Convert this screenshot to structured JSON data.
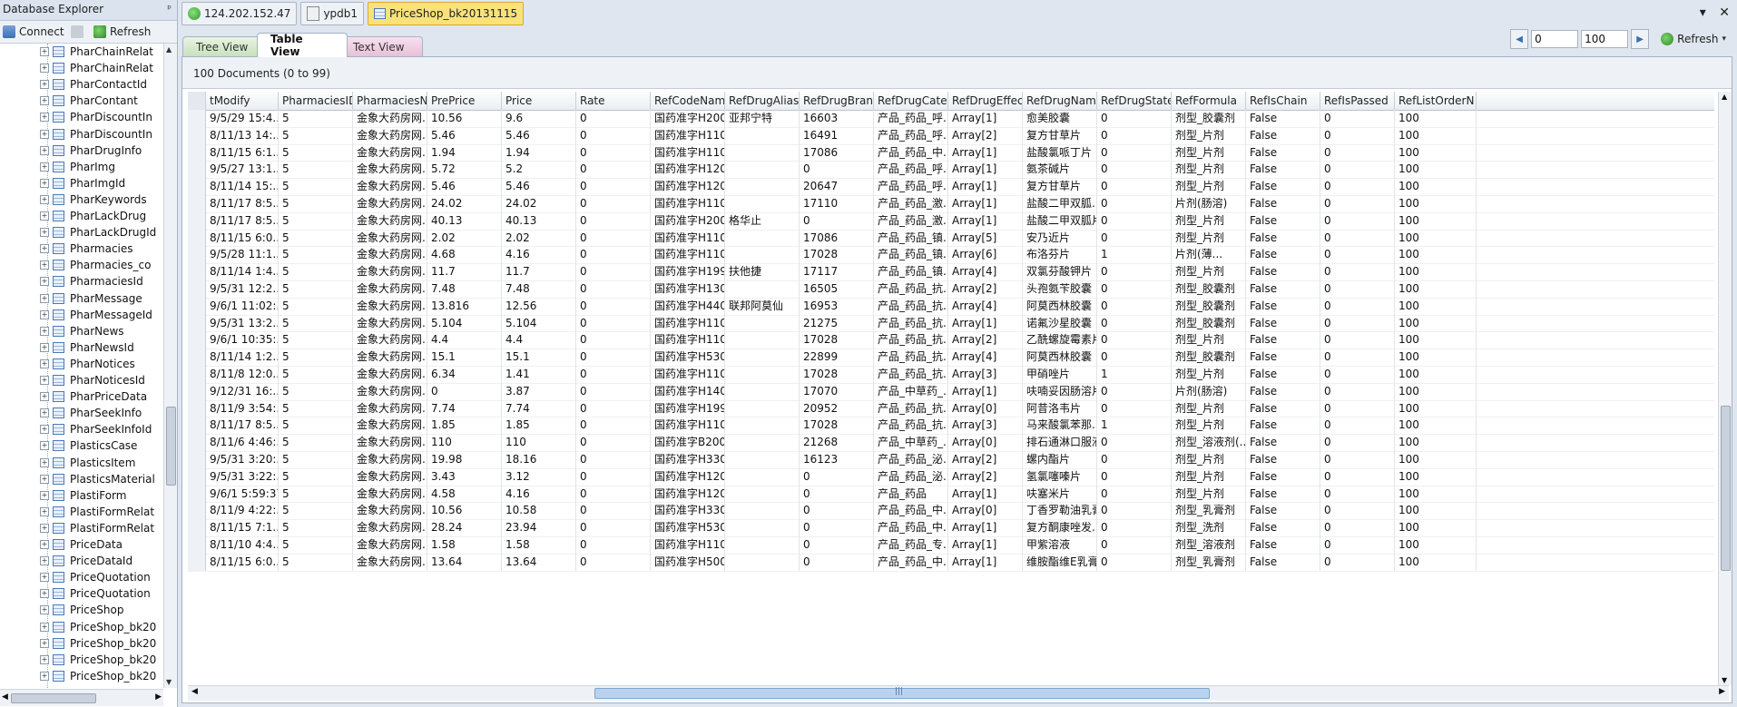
{
  "explorer": {
    "title": "Database Explorer",
    "pin": "ᵖ",
    "connect_label": "Connect",
    "refresh_label": "Refresh",
    "items": [
      "PharChainRelat",
      "PharChainRelat",
      "PharContactId",
      "PharContant",
      "PharDiscountIn",
      "PharDiscountIn",
      "PharDrugInfo",
      "PharImg",
      "PharImgId",
      "PharKeywords",
      "PharLackDrug",
      "PharLackDrugId",
      "Pharmacies",
      "Pharmacies_co",
      "PharmaciesId",
      "PharMessage",
      "PharMessageId",
      "PharNews",
      "PharNewsId",
      "PharNotices",
      "PharNoticesId",
      "PharPriceData",
      "PharSeekInfo",
      "PharSeekInfoId",
      "PlasticsCase",
      "PlasticsItem",
      "PlasticsMaterial",
      "PlastiForm",
      "PlastiFormRelat",
      "PlastiFormRelat",
      "PriceData",
      "PriceDataId",
      "PriceQuotation",
      "PriceQuotation",
      "PriceShop",
      "PriceShop_bk20",
      "PriceShop_bk20",
      "PriceShop_bk20",
      "PriceShop_bk20"
    ]
  },
  "tabs": {
    "server": "124.202.152.47",
    "database": "ypdb1",
    "collection": "PriceShop_bk20131115"
  },
  "views": {
    "tree": "Tree View",
    "table": "Table View",
    "text": "Text View"
  },
  "paging": {
    "skip": "0",
    "limit": "100",
    "refresh_label": "Refresh"
  },
  "doc_count": "100 Documents (0 to 99)",
  "table": {
    "columns": [
      "tModify",
      "PharmaciesID",
      "PharmaciesNa...",
      "PrePrice",
      "Price",
      "Rate",
      "RefCodeName",
      "RefDrugAliasCN",
      "RefDrugBrandID",
      "RefDrugCateg...",
      "RefDrugEffect",
      "RefDrugName...",
      "RefDrugStateID",
      "RefFormula",
      "RefIsChain",
      "RefIsPassed",
      "RefListOrderN"
    ],
    "rows": [
      [
        "9/5/29 15:4...",
        "5",
        "金象大药房网...",
        "10.56",
        "9.6",
        "0",
        "国药准字H200...",
        "亚邦宁特",
        "16603",
        "产品_药品_呼...",
        "Array[1]",
        "愈美胶囊",
        "0",
        "剂型_胶囊剂",
        "False",
        "0",
        "100"
      ],
      [
        "8/11/13 14:...",
        "5",
        "金象大药房网...",
        "5.46",
        "5.46",
        "0",
        "国药准字H110...",
        "",
        "16491",
        "产品_药品_呼...",
        "Array[2]",
        "复方甘草片",
        "0",
        "剂型_片剂",
        "False",
        "0",
        "100"
      ],
      [
        "8/11/15 6:1...",
        "5",
        "金象大药房网...",
        "1.94",
        "1.94",
        "0",
        "国药准字H110...",
        "",
        "17086",
        "产品_药品_中...",
        "Array[1]",
        "盐酸氯哌丁片",
        "0",
        "剂型_片剂",
        "False",
        "0",
        "100"
      ],
      [
        "9/5/27 13:1...",
        "5",
        "金象大药房网...",
        "5.72",
        "5.2",
        "0",
        "国药准字H120...",
        "",
        "0",
        "产品_药品_呼...",
        "Array[1]",
        "氨茶碱片",
        "0",
        "剂型_片剂",
        "False",
        "0",
        "100"
      ],
      [
        "8/11/14 15:...",
        "5",
        "金象大药房网...",
        "5.46",
        "5.46",
        "0",
        "国药准字H120...",
        "",
        "20647",
        "产品_药品_呼...",
        "Array[1]",
        "复方甘草片",
        "0",
        "剂型_片剂",
        "False",
        "0",
        "100"
      ],
      [
        "8/11/17 8:5...",
        "5",
        "金象大药房网...",
        "24.02",
        "24.02",
        "0",
        "国药准字H110...",
        "",
        "17110",
        "产品_药品_激...",
        "Array[1]",
        "盐酸二甲双胍...",
        "0",
        "片剂(肠溶)",
        "False",
        "0",
        "100"
      ],
      [
        "8/11/17 8:5...",
        "5",
        "金象大药房网...",
        "40.13",
        "40.13",
        "0",
        "国药准字H200...",
        "格华止",
        "0",
        "产品_药品_激...",
        "Array[1]",
        "盐酸二甲双胍片",
        "0",
        "剂型_片剂",
        "False",
        "0",
        "100"
      ],
      [
        "8/11/15 6:0...",
        "5",
        "金象大药房网...",
        "2.02",
        "2.02",
        "0",
        "国药准字H110...",
        "",
        "17086",
        "产品_药品_镇...",
        "Array[5]",
        "安乃近片",
        "0",
        "剂型_片剂",
        "False",
        "0",
        "100"
      ],
      [
        "9/5/28 11:1...",
        "5",
        "金象大药房网...",
        "4.68",
        "4.16",
        "0",
        "国药准字H110...",
        "",
        "17028",
        "产品_药品_镇...",
        "Array[6]",
        "布洛芬片",
        "1",
        "片剂(薄...",
        "False",
        "0",
        "100"
      ],
      [
        "8/11/14 1:4...",
        "5",
        "金象大药房网...",
        "11.7",
        "11.7",
        "0",
        "国药准字H199...",
        "扶他捷",
        "17117",
        "产品_药品_镇...",
        "Array[4]",
        "双氯芬酸钾片",
        "0",
        "剂型_片剂",
        "False",
        "0",
        "100"
      ],
      [
        "9/5/31 12:2...",
        "5",
        "金象大药房网...",
        "7.48",
        "7.48",
        "0",
        "国药准字H130...",
        "",
        "16505",
        "产品_药品_抗...",
        "Array[2]",
        "头孢氨苄胶囊",
        "0",
        "剂型_胶囊剂",
        "False",
        "0",
        "100"
      ],
      [
        "9/6/1 11:02:...",
        "5",
        "金象大药房网...",
        "13.816",
        "12.56",
        "0",
        "国药准字H440...",
        "联邦阿莫仙",
        "16953",
        "产品_药品_抗...",
        "Array[4]",
        "阿莫西林胶囊",
        "0",
        "剂型_胶囊剂",
        "False",
        "0",
        "100"
      ],
      [
        "9/5/31 13:2...",
        "5",
        "金象大药房网...",
        "5.104",
        "5.104",
        "0",
        "国药准字H110...",
        "",
        "21275",
        "产品_药品_抗...",
        "Array[1]",
        "诺氟沙星胶囊",
        "0",
        "剂型_胶囊剂",
        "False",
        "0",
        "100"
      ],
      [
        "9/6/1 10:35:...",
        "5",
        "金象大药房网...",
        "4.4",
        "4.4",
        "0",
        "国药准字H110...",
        "",
        "17028",
        "产品_药品_抗...",
        "Array[2]",
        "乙酰螺旋霉素片",
        "0",
        "剂型_片剂",
        "False",
        "0",
        "100"
      ],
      [
        "8/11/14 1:2...",
        "5",
        "金象大药房网...",
        "15.1",
        "15.1",
        "0",
        "国药准字H530...",
        "",
        "22899",
        "产品_药品_抗...",
        "Array[4]",
        "阿莫西林胶囊",
        "0",
        "剂型_胶囊剂",
        "False",
        "0",
        "100"
      ],
      [
        "8/11/8 12:0...",
        "5",
        "金象大药房网...",
        "6.34",
        "1.41",
        "0",
        "国药准字H110...",
        "",
        "17028",
        "产品_药品_抗...",
        "Array[3]",
        "甲硝唑片",
        "1",
        "剂型_片剂",
        "False",
        "0",
        "100"
      ],
      [
        "9/12/31 16:...",
        "5",
        "金象大药房网...",
        "0",
        "3.87",
        "0",
        "国药准字H140...",
        "",
        "17070",
        "产品_中草药_...",
        "Array[1]",
        "呋喃妥因肠溶片",
        "0",
        "片剂(肠溶)",
        "False",
        "0",
        "100"
      ],
      [
        "8/11/9 3:54:...",
        "5",
        "金象大药房网...",
        "7.74",
        "7.74",
        "0",
        "国药准字H199...",
        "",
        "20952",
        "产品_药品_抗...",
        "Array[0]",
        "阿昔洛韦片",
        "0",
        "剂型_片剂",
        "False",
        "0",
        "100"
      ],
      [
        "8/11/17 8:5...",
        "5",
        "金象大药房网...",
        "1.85",
        "1.85",
        "0",
        "国药准字H110...",
        "",
        "17028",
        "产品_药品_抗...",
        "Array[3]",
        "马来酸氯苯那...",
        "1",
        "剂型_片剂",
        "False",
        "0",
        "100"
      ],
      [
        "8/11/6 4:46:...",
        "5",
        "金象大药房网...",
        "110",
        "110",
        "0",
        "国药准字B2003...",
        "",
        "21268",
        "产品_中草药_...",
        "Array[0]",
        "排石通淋口服液",
        "0",
        "剂型_溶液剂(...",
        "False",
        "0",
        "100"
      ],
      [
        "9/5/31 3:20:...",
        "5",
        "金象大药房网...",
        "19.98",
        "18.16",
        "0",
        "国药准字H330...",
        "",
        "16123",
        "产品_药品_泌...",
        "Array[2]",
        "螺内酯片",
        "0",
        "剂型_片剂",
        "False",
        "0",
        "100"
      ],
      [
        "9/5/31 3:22:...",
        "5",
        "金象大药房网...",
        "3.43",
        "3.12",
        "0",
        "国药准字H120...",
        "",
        "0",
        "产品_药品_泌...",
        "Array[2]",
        "氢氯噻嗪片",
        "0",
        "剂型_片剂",
        "False",
        "0",
        "100"
      ],
      [
        "9/6/1 5:59:37",
        "5",
        "金象大药房网...",
        "4.58",
        "4.16",
        "0",
        "国药准字H120...",
        "",
        "0",
        "产品_药品",
        "Array[1]",
        "呋塞米片",
        "0",
        "剂型_片剂",
        "False",
        "0",
        "100"
      ],
      [
        "8/11/9 4:22:...",
        "5",
        "金象大药房网...",
        "10.56",
        "10.58",
        "0",
        "国药准字H330...",
        "",
        "0",
        "产品_药品_中...",
        "Array[0]",
        "丁香罗勒油乳膏",
        "0",
        "剂型_乳膏剂",
        "False",
        "0",
        "100"
      ],
      [
        "8/11/15 7:1...",
        "5",
        "金象大药房网...",
        "28.24",
        "23.94",
        "0",
        "国药准字H530...",
        "",
        "0",
        "产品_药品_中...",
        "Array[1]",
        "复方酮康唑发...",
        "0",
        "剂型_洗剂",
        "False",
        "0",
        "100"
      ],
      [
        "8/11/10 4:4...",
        "5",
        "金象大药房网...",
        "1.58",
        "1.58",
        "0",
        "国药准字H110...",
        "",
        "0",
        "产品_药品_专...",
        "Array[1]",
        "甲紫溶液",
        "0",
        "剂型_溶液剂",
        "False",
        "0",
        "100"
      ],
      [
        "8/11/15 6:0...",
        "5",
        "金象大药房网...",
        "13.64",
        "13.64",
        "0",
        "国药准字H500...",
        "",
        "0",
        "产品_药品_中...",
        "Array[1]",
        "维胺酯维E乳膏",
        "0",
        "剂型_乳膏剂",
        "False",
        "0",
        "100"
      ]
    ]
  }
}
